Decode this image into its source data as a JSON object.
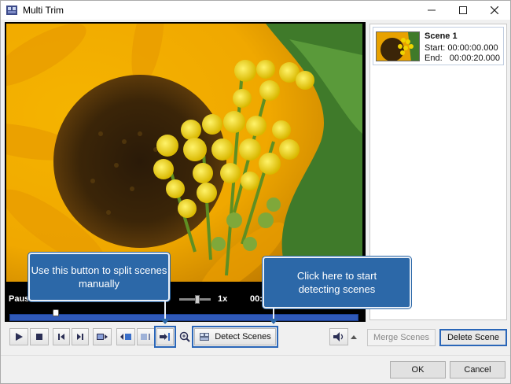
{
  "window": {
    "title": "Multi Trim",
    "minimize_icon": "minimize-icon",
    "maximize_icon": "maximize-icon",
    "close_icon": "close-icon"
  },
  "player": {
    "status": "Pause",
    "speed": "1x",
    "time": "00:",
    "timeline_position": 0.13
  },
  "toolbar": {
    "play_icon": "play-icon",
    "stop_icon": "stop-icon",
    "prev_icon": "previous-frame-icon",
    "next_icon": "next-frame-icon",
    "detect_scenes_label": "Detect Scenes",
    "volume_icon": "speaker-icon"
  },
  "scenes": [
    {
      "name": "Scene 1",
      "start": "Start: 00:00:00.000",
      "end": "End:   00:00:20.000"
    }
  ],
  "side_buttons": {
    "merge_label": "Merge Scenes",
    "delete_label": "Delete Scene"
  },
  "dialog": {
    "ok_label": "OK",
    "cancel_label": "Cancel"
  },
  "callouts": {
    "split": "Use this button to split scenes manually",
    "detect": "Click here to start detecting scenes"
  },
  "colors": {
    "accent": "#2c68a8",
    "timeline": "#2f59b8"
  }
}
